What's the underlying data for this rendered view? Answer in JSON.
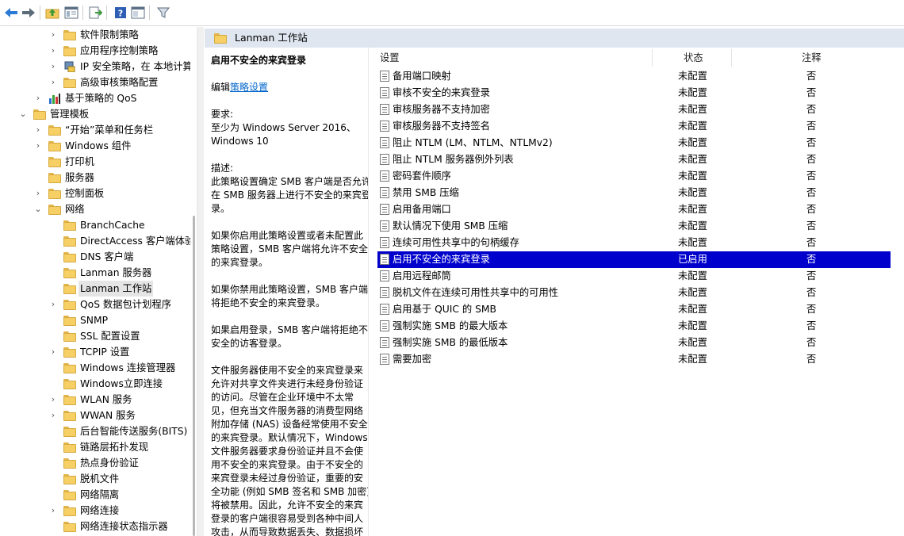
{
  "toolbar": {
    "icons": [
      "back-arrow-icon",
      "forward-arrow-icon",
      "up-folder-icon",
      "show-hide-tree-icon",
      "export-list-icon",
      "help-icon",
      "properties-icon",
      "filter-icon"
    ]
  },
  "tree": {
    "items": [
      {
        "label": "软件限制策略",
        "level": 2,
        "chevron": "›",
        "icon": "folder"
      },
      {
        "label": "应用程序控制策略",
        "level": 2,
        "chevron": "›",
        "icon": "folder"
      },
      {
        "label": "IP 安全策略，在 本地计算机",
        "level": 2,
        "chevron": "›",
        "icon": "ip-security"
      },
      {
        "label": "高级审核策略配置",
        "level": 2,
        "chevron": "›",
        "icon": "folder"
      },
      {
        "label": "基于策略的 QoS",
        "level": 1,
        "chevron": "›",
        "icon": "qos-chart"
      },
      {
        "label": "管理模板",
        "level": 0,
        "chevron": "⌄",
        "icon": "folder"
      },
      {
        "label": "“开始”菜单和任务栏",
        "level": 1,
        "chevron": "›",
        "icon": "folder"
      },
      {
        "label": "Windows 组件",
        "level": 1,
        "chevron": "›",
        "icon": "folder"
      },
      {
        "label": "打印机",
        "level": 1,
        "chevron": "",
        "icon": "folder"
      },
      {
        "label": "服务器",
        "level": 1,
        "chevron": "",
        "icon": "folder"
      },
      {
        "label": "控制面板",
        "level": 1,
        "chevron": "›",
        "icon": "folder"
      },
      {
        "label": "网络",
        "level": 1,
        "chevron": "⌄",
        "icon": "folder"
      },
      {
        "label": "BranchCache",
        "level": 2,
        "chevron": "",
        "icon": "folder"
      },
      {
        "label": "DirectAccess 客户端体验设置",
        "level": 2,
        "chevron": "",
        "icon": "folder"
      },
      {
        "label": "DNS 客户端",
        "level": 2,
        "chevron": "",
        "icon": "folder"
      },
      {
        "label": "Lanman 服务器",
        "level": 2,
        "chevron": "",
        "icon": "folder"
      },
      {
        "label": "Lanman 工作站",
        "level": 2,
        "chevron": "",
        "icon": "folder",
        "selected": true
      },
      {
        "label": "QoS 数据包计划程序",
        "level": 2,
        "chevron": "›",
        "icon": "folder"
      },
      {
        "label": "SNMP",
        "level": 2,
        "chevron": "",
        "icon": "folder"
      },
      {
        "label": "SSL 配置设置",
        "level": 2,
        "chevron": "",
        "icon": "folder"
      },
      {
        "label": "TCPIP 设置",
        "level": 2,
        "chevron": "›",
        "icon": "folder"
      },
      {
        "label": "Windows 连接管理器",
        "level": 2,
        "chevron": "",
        "icon": "folder"
      },
      {
        "label": "Windows立即连接",
        "level": 2,
        "chevron": "",
        "icon": "folder"
      },
      {
        "label": "WLAN 服务",
        "level": 2,
        "chevron": "›",
        "icon": "folder"
      },
      {
        "label": "WWAN 服务",
        "level": 2,
        "chevron": "›",
        "icon": "folder"
      },
      {
        "label": "后台智能传送服务(BITS)",
        "level": 2,
        "chevron": "",
        "icon": "folder"
      },
      {
        "label": "链路层拓扑发现",
        "level": 2,
        "chevron": "",
        "icon": "folder"
      },
      {
        "label": "热点身份验证",
        "level": 2,
        "chevron": "",
        "icon": "folder"
      },
      {
        "label": "脱机文件",
        "level": 2,
        "chevron": "",
        "icon": "folder"
      },
      {
        "label": "网络隔离",
        "level": 2,
        "chevron": "",
        "icon": "folder"
      },
      {
        "label": "网络连接",
        "level": 2,
        "chevron": "›",
        "icon": "folder"
      },
      {
        "label": "网络连接状态指示器",
        "level": 2,
        "chevron": "",
        "icon": "folder"
      }
    ]
  },
  "header": {
    "title": "Lanman 工作站"
  },
  "description": {
    "title": "启用不安全的来宾登录",
    "edit_prefix": "编辑",
    "edit_link": "策略设置",
    "requirements_label": "要求:",
    "requirements": "至少为 Windows Server 2016、Windows 10",
    "description_label": "描述:",
    "p1": "此策略设置确定 SMB 客户端是否允许在 SMB 服务器上进行不安全的来宾登录。",
    "p2": "如果你启用此策略设置或者未配置此策略设置，SMB 客户端将允许不安全的来宾登录。",
    "p3": "如果你禁用此策略设置，SMB 客户端将拒绝不安全的来宾登录。",
    "p4": "如果启用登录，SMB 客户端将拒绝不安全的访客登录。",
    "p5": "文件服务器使用不安全的来宾登录来允许对共享文件夹进行未经身份验证的访问。尽管在企业环境中不太常见，但充当文件服务器的消费型网络附加存储 (NAS) 设备经常使用不安全的来宾登录。默认情况下，Windows 文件服务器要求身份验证并且不会使用不安全的来宾登录。由于不安全的来宾登录未经过身份验证，重要的安全功能 (例如 SMB 签名和 SMB 加密) 将被禁用。因此，允许不安全的来宾登录的客户端很容易受到各种中间人攻击，从而导致数据丢失、数据损坏"
  },
  "list": {
    "columns": {
      "setting": "设置",
      "state": "状态",
      "comment": "注释"
    },
    "rows": [
      {
        "name": "备用端口映射",
        "state": "未配置",
        "comment": "否"
      },
      {
        "name": "审核不安全的来宾登录",
        "state": "未配置",
        "comment": "否"
      },
      {
        "name": "审核服务器不支持加密",
        "state": "未配置",
        "comment": "否"
      },
      {
        "name": "审核服务器不支持签名",
        "state": "未配置",
        "comment": "否"
      },
      {
        "name": "阻止 NTLM (LM、NTLM、NTLMv2)",
        "state": "未配置",
        "comment": "否"
      },
      {
        "name": "阻止 NTLM 服务器例外列表",
        "state": "未配置",
        "comment": "否"
      },
      {
        "name": "密码套件顺序",
        "state": "未配置",
        "comment": "否"
      },
      {
        "name": "禁用 SMB 压缩",
        "state": "未配置",
        "comment": "否"
      },
      {
        "name": "启用备用端口",
        "state": "未配置",
        "comment": "否"
      },
      {
        "name": "默认情况下使用 SMB 压缩",
        "state": "未配置",
        "comment": "否"
      },
      {
        "name": "连续可用性共享中的句柄缓存",
        "state": "未配置",
        "comment": "否"
      },
      {
        "name": "启用不安全的来宾登录",
        "state": "已启用",
        "comment": "否",
        "selected": true
      },
      {
        "name": "启用远程邮筒",
        "state": "未配置",
        "comment": "否"
      },
      {
        "name": "脱机文件在连续可用性共享中的可用性",
        "state": "未配置",
        "comment": "否"
      },
      {
        "name": "启用基于 QUIC 的 SMB",
        "state": "未配置",
        "comment": "否"
      },
      {
        "name": "强制实施 SMB 的最大版本",
        "state": "未配置",
        "comment": "否"
      },
      {
        "name": "强制实施 SMB 的最低版本",
        "state": "未配置",
        "comment": "否"
      },
      {
        "name": "需要加密",
        "state": "未配置",
        "comment": "否"
      }
    ]
  },
  "colors": {
    "selection": "#0000cc",
    "header_bg": "#dfe6ef",
    "link": "#0066cc"
  }
}
